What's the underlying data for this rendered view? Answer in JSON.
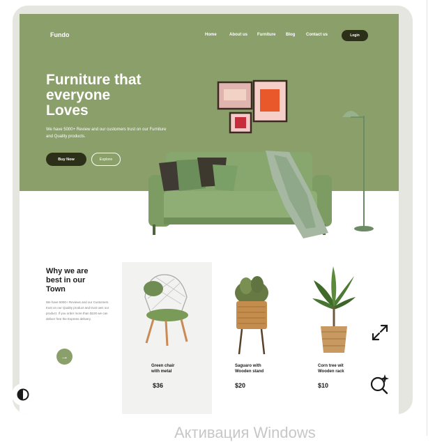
{
  "site": {
    "logo": "Fundo",
    "nav": [
      {
        "label": "Home"
      },
      {
        "label": "About us"
      },
      {
        "label": "Furniture"
      },
      {
        "label": "Blog"
      },
      {
        "label": "Contact us"
      }
    ],
    "login_label": "Login"
  },
  "hero": {
    "headline_line1": "Furniture that",
    "headline_line2": "everyone",
    "headline_line3": "Loves",
    "subtext": "We have 5000+ Review and our customers trust on our Furniture and Quality products.",
    "buy_label": "Buy Now",
    "explore_label": "Explore"
  },
  "why": {
    "title": "Why we are best in our Town",
    "text": "We have 5000+ Reviews and our Customers trust on our Quality product and trust own our product. If you order more than $100 we can deliver free the Express delivery."
  },
  "products": [
    {
      "name_line1": "Green chair",
      "name_line2": "with metal",
      "price": "$36"
    },
    {
      "name_line1": "Saguaro with",
      "name_line2": "Wooden stand",
      "price": "$20"
    },
    {
      "name_line1": "Corn tree wit",
      "name_line2": "Wooden rack",
      "price": "$10"
    }
  ],
  "overlay": {
    "expand_icon": "expand-icon",
    "visual_search_icon": "visual-search-sparkle-icon",
    "theme_icon": "contrast-toggle-icon"
  },
  "watermark": "Активация Windows",
  "colors": {
    "hero_green": "#8a9f69",
    "dark_button": "#2c3019",
    "frame": "#e5e6e0"
  }
}
